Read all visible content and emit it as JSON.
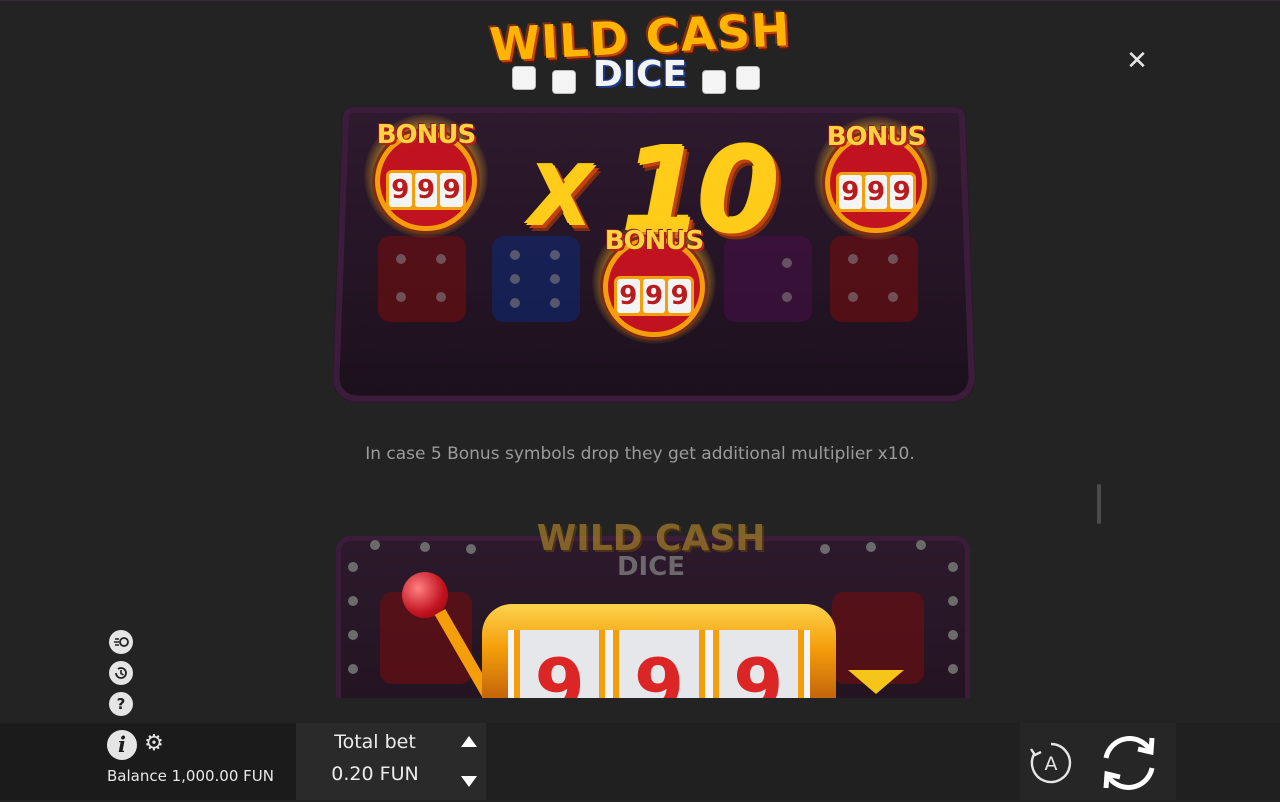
{
  "logo": {
    "line1": "WILD CASH",
    "line2": "DICE"
  },
  "close_icon": "close-icon",
  "illustration_1": {
    "multiplier_x": "X",
    "multiplier_value": "10",
    "badges": [
      {
        "label": "BONUS",
        "reels": [
          "9",
          "9",
          "9"
        ]
      },
      {
        "label": "BONUS",
        "reels": [
          "9",
          "9",
          "9"
        ]
      },
      {
        "label": "BONUS",
        "reels": [
          "9",
          "9",
          "9"
        ]
      }
    ]
  },
  "description": "In case 5 Bonus symbols drop they get additional multiplier x10.",
  "illustration_2": {
    "logo_line1": "WILD CASH",
    "logo_line2": "DICE",
    "reels": [
      "9",
      "9",
      "9"
    ]
  },
  "side_icons": [
    "speed-icon",
    "history-icon",
    "help-icon"
  ],
  "side_icon_glyphs": {
    "help": "?"
  },
  "bottom_bar": {
    "balance_label": "Balance 1,000.00 FUN",
    "total_bet_label": "Total bet",
    "total_bet_value": "0.20 FUN",
    "info_glyph": "i",
    "gear_glyph": "⚙",
    "auto_glyph": "A"
  },
  "colors": {
    "background": "#232323",
    "accent_gold": "#ffb400",
    "bonus_red": "#c1121f"
  }
}
